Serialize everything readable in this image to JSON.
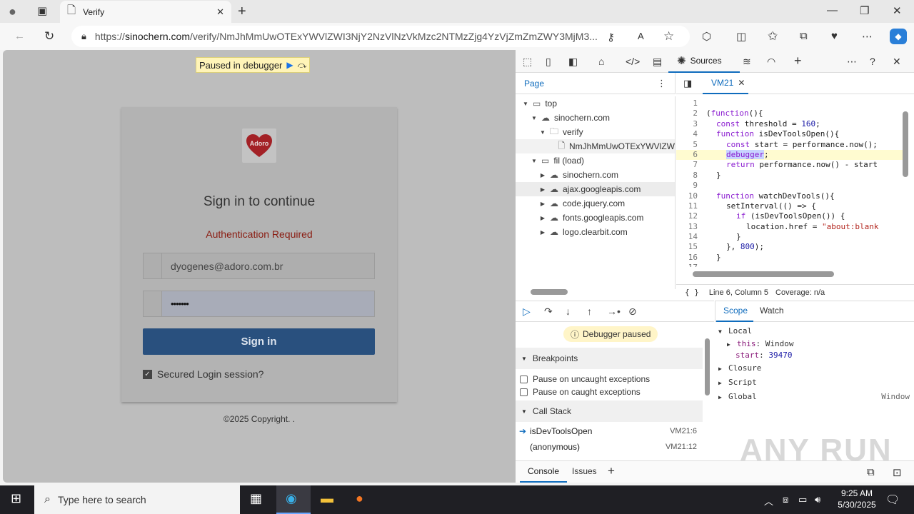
{
  "browser": {
    "tab_title": "Verify",
    "url_scheme": "https://",
    "url_host": "sinochern.com",
    "url_path": "/verify/NmJhMmUwOTExYWVlZWI3NjY2NzVlNzVkMzc2NTMzZjg4YzVjZmZmZWY3MjM3..."
  },
  "page": {
    "paused_label": "Paused in debugger",
    "logo_text": "Adoro",
    "title": "Sign in to continue",
    "auth_message": "Authentication Required",
    "email_value": "dyogenes@adoro.com.br",
    "password_value": "•••••••",
    "signin_label": "Sign in",
    "checkbox_label": "Secured Login session?",
    "copyright": "©2025 Copyright. ."
  },
  "devtools": {
    "sources_label": "Sources",
    "page_tab": "Page",
    "editor_tab": "VM21",
    "tree": [
      {
        "label": "top",
        "depth": 0,
        "arrow": "▼",
        "icon": "▭"
      },
      {
        "label": "sinochern.com",
        "depth": 1,
        "arrow": "▼",
        "icon": "☁"
      },
      {
        "label": "verify",
        "depth": 2,
        "arrow": "▼",
        "icon": "🗀"
      },
      {
        "label": "NmJhMmUwOTExYWVlZW",
        "depth": 3,
        "arrow": "",
        "icon": "🗋"
      },
      {
        "label": "fil (load)",
        "depth": 1,
        "arrow": "▼",
        "icon": "▭"
      },
      {
        "label": "sinochern.com",
        "depth": 2,
        "arrow": "▶",
        "icon": "☁"
      },
      {
        "label": "ajax.googleapis.com",
        "depth": 2,
        "arrow": "▶",
        "icon": "☁"
      },
      {
        "label": "code.jquery.com",
        "depth": 2,
        "arrow": "▶",
        "icon": "☁"
      },
      {
        "label": "fonts.googleapis.com",
        "depth": 2,
        "arrow": "▶",
        "icon": "☁"
      },
      {
        "label": "logo.clearbit.com",
        "depth": 2,
        "arrow": "▶",
        "icon": "☁"
      }
    ],
    "status_position": "Line 6, Column 5",
    "status_coverage": "Coverage: n/a",
    "debugger_paused": "Debugger paused",
    "breakpoints_label": "Breakpoints",
    "pause_uncaught": "Pause on uncaught exceptions",
    "pause_caught": "Pause on caught exceptions",
    "callstack_label": "Call Stack",
    "callstack": [
      {
        "fn": "isDevToolsOpen",
        "loc": "VM21:6"
      },
      {
        "fn": "(anonymous)",
        "loc": "VM21:12"
      }
    ],
    "scope_tab": "Scope",
    "watch_tab": "Watch",
    "scope": {
      "local": "Local",
      "this_key": "this",
      "this_val": "Window",
      "start_key": "start",
      "start_val": "39470",
      "closure": "Closure",
      "script": "Script",
      "global": "Global",
      "global_val": "Window"
    },
    "console_tab": "Console",
    "issues_tab": "Issues"
  },
  "watermark": "ANY RUN",
  "taskbar": {
    "search_placeholder": "Type here to search",
    "time": "9:25 AM",
    "date": "5/30/2025"
  }
}
